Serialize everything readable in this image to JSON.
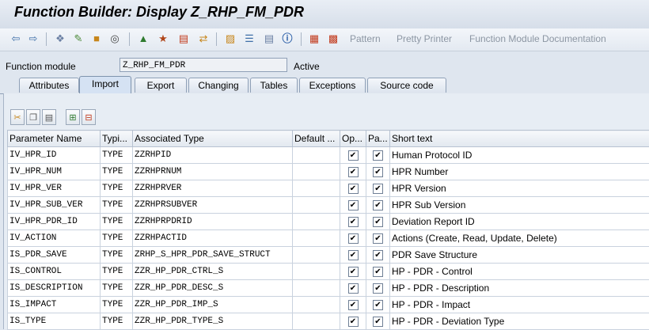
{
  "title": "Function Builder: Display Z_RHP_FM_PDR",
  "toolbar": {
    "icons": [
      "back-arrow-icon",
      "forward-arrow-icon",
      "other-object-icon",
      "display-change-icon",
      "activate-icon",
      "check-icon",
      "where-used-icon",
      "test-icon",
      "display-object-list-icon",
      "navigation-window-icon",
      "hierarchy-icon",
      "stack-icon",
      "help-icon",
      "info-icon",
      "insert-icon",
      "delete-icon"
    ],
    "pattern_label": "Pattern",
    "pretty_printer_label": "Pretty Printer",
    "documentation_label": "Function Module Documentation"
  },
  "function_module": {
    "label": "Function module",
    "value": "Z_RHP_FM_PDR",
    "status": "Active"
  },
  "tabs": [
    {
      "label": "Attributes"
    },
    {
      "label": "Import",
      "active": true
    },
    {
      "label": "Export"
    },
    {
      "label": "Changing"
    },
    {
      "label": "Tables"
    },
    {
      "label": "Exceptions"
    },
    {
      "label": "Source code"
    }
  ],
  "table": {
    "headers": [
      "Parameter Name",
      "Typi...",
      "Associated Type",
      "Default ...",
      "Op...",
      "Pa...",
      "Short text"
    ],
    "rows": [
      {
        "name": "IV_HPR_ID",
        "typing": "TYPE",
        "assoc": "ZZRHPID",
        "default": "",
        "optional": true,
        "pass_value": true,
        "text": "Human Protocol ID"
      },
      {
        "name": "IV_HPR_NUM",
        "typing": "TYPE",
        "assoc": "ZZRHPRNUM",
        "default": "",
        "optional": true,
        "pass_value": true,
        "text": "HPR Number"
      },
      {
        "name": "IV_HPR_VER",
        "typing": "TYPE",
        "assoc": "ZZRHPRVER",
        "default": "",
        "optional": true,
        "pass_value": true,
        "text": "HPR Version"
      },
      {
        "name": "IV_HPR_SUB_VER",
        "typing": "TYPE",
        "assoc": "ZZRHPRSUBVER",
        "default": "",
        "optional": true,
        "pass_value": true,
        "text": "HPR Sub Version"
      },
      {
        "name": "IV_HPR_PDR_ID",
        "typing": "TYPE",
        "assoc": "ZZRHPRPDRID",
        "default": "",
        "optional": true,
        "pass_value": true,
        "text": "Deviation Report ID"
      },
      {
        "name": "IV_ACTION",
        "typing": "TYPE",
        "assoc": "ZZRHPACTID",
        "default": "",
        "optional": true,
        "pass_value": true,
        "text": "Actions (Create, Read, Update, Delete)"
      },
      {
        "name": "IS_PDR_SAVE",
        "typing": "TYPE",
        "assoc": "ZRHP_S_HPR_PDR_SAVE_STRUCT",
        "default": "",
        "optional": true,
        "pass_value": true,
        "text": "PDR Save Structure"
      },
      {
        "name": "IS_CONTROL",
        "typing": "TYPE",
        "assoc": "ZZR_HP_PDR_CTRL_S",
        "default": "",
        "optional": true,
        "pass_value": true,
        "text": "HP - PDR - Control"
      },
      {
        "name": "IS_DESCRIPTION",
        "typing": "TYPE",
        "assoc": "ZZR_HP_PDR_DESC_S",
        "default": "",
        "optional": true,
        "pass_value": true,
        "text": "HP - PDR - Description"
      },
      {
        "name": "IS_IMPACT",
        "typing": "TYPE",
        "assoc": "ZZR_HP_PDR_IMP_S",
        "default": "",
        "optional": true,
        "pass_value": true,
        "text": "HP - PDR - Impact"
      },
      {
        "name": "IS_TYPE",
        "typing": "TYPE",
        "assoc": "ZZR_HP_PDR_TYPE_S",
        "default": "",
        "optional": true,
        "pass_value": true,
        "text": "HP - PDR - Deviation Type"
      }
    ]
  },
  "colors": {
    "accent": "#d5e2f3",
    "background": "#dfe6ef"
  }
}
